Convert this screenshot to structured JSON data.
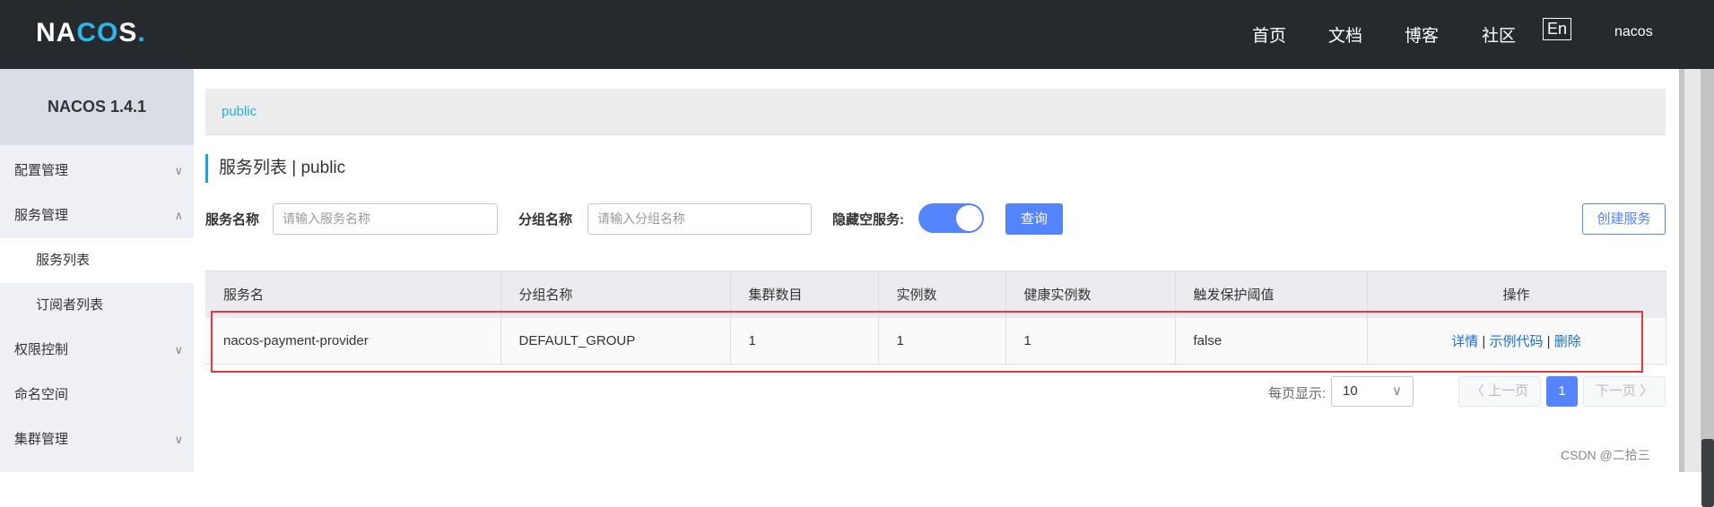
{
  "header": {
    "logo": "NACOS.",
    "nav": [
      "首页",
      "文档",
      "博客",
      "社区"
    ],
    "lang": "En",
    "user": "nacos"
  },
  "sidebar": {
    "title": "NACOS 1.4.1",
    "items": [
      {
        "label": "配置管理",
        "chevron": "∨"
      },
      {
        "label": "服务管理",
        "chevron": "∧"
      },
      {
        "label": "服务列表"
      },
      {
        "label": "订阅者列表"
      },
      {
        "label": "权限控制",
        "chevron": "∨"
      },
      {
        "label": "命名空间"
      },
      {
        "label": "集群管理",
        "chevron": "∨"
      }
    ]
  },
  "breadcrumb": "public",
  "page_title": "服务列表 | public",
  "filters": {
    "service_label": "服务名称",
    "service_placeholder": "请输入服务名称",
    "group_label": "分组名称",
    "group_placeholder": "请输入分组名称",
    "hide_empty_label": "隐藏空服务:",
    "hide_empty_on": true,
    "query": "查询",
    "create": "创建服务"
  },
  "table": {
    "headers": [
      "服务名",
      "分组名称",
      "集群数目",
      "实例数",
      "健康实例数",
      "触发保护阈值",
      "操作"
    ],
    "rows": [
      {
        "name": "nacos-payment-provider",
        "group": "DEFAULT_GROUP",
        "clusters": "1",
        "instances": "1",
        "healthy": "1",
        "threshold": "false",
        "ops": [
          "详情",
          "示例代码",
          "删除"
        ]
      }
    ]
  },
  "pagination": {
    "per_page_label": "每页显示:",
    "per_page": "10",
    "prev": "〈 上一页",
    "current": "1",
    "next": "下一页 〉"
  },
  "watermark": "CSDN @二拾三"
}
